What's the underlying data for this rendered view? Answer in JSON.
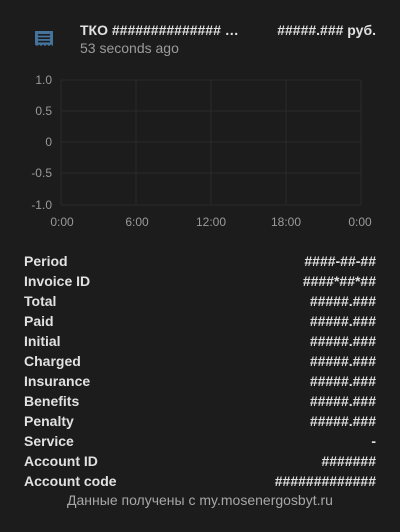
{
  "header": {
    "icon": "invoice-icon",
    "title": "ТКО ############## …",
    "state": "#####.### руб.",
    "last_changed": "53 seconds ago"
  },
  "graph": {
    "y_ticks": [
      "1.0",
      "0.5",
      "0",
      "-0.5",
      "-1.0"
    ],
    "x_ticks": [
      "0:00",
      "6:00",
      "12:00",
      "18:00",
      "0:00"
    ]
  },
  "attributes": [
    {
      "label": "Period",
      "value": "####-##-##"
    },
    {
      "label": "Invoice ID",
      "value": "####*##*##"
    },
    {
      "label": "Total",
      "value": "#####.###"
    },
    {
      "label": "Paid",
      "value": "#####.###"
    },
    {
      "label": "Initial",
      "value": "#####.###"
    },
    {
      "label": "Charged",
      "value": "#####.###"
    },
    {
      "label": "Insurance",
      "value": "#####.###"
    },
    {
      "label": "Benefits",
      "value": "#####.###"
    },
    {
      "label": "Penalty",
      "value": "#####.###"
    },
    {
      "label": "Service",
      "value": "-"
    },
    {
      "label": "Account ID",
      "value": "#######"
    },
    {
      "label": "Account code",
      "value": "#############"
    }
  ],
  "footer": {
    "attribution": "Данные получены с my.mosenergosbyt.ru"
  },
  "colors": {
    "background": "#1c1c1c",
    "icon": "#44739e",
    "text": "#e1e1e1",
    "secondary": "#9b9b9b"
  }
}
